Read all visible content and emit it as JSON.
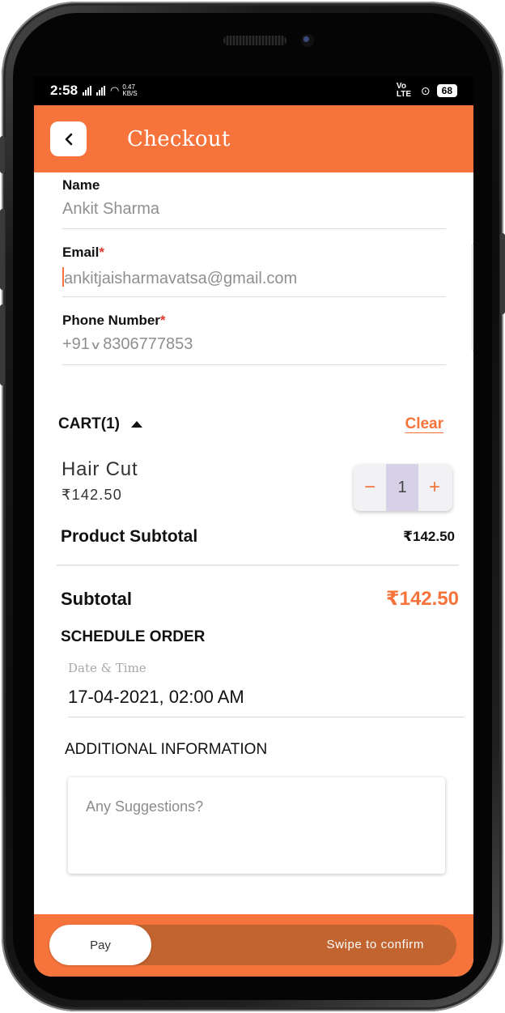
{
  "status_bar": {
    "time": "2:58",
    "net_speed_value": "0.47",
    "net_speed_unit": "KB/S",
    "volte": "Vo LTE",
    "battery": "68"
  },
  "header": {
    "back_icon": "chevron-left-icon",
    "title": "Checkout"
  },
  "form": {
    "name_label": "Name",
    "name_value": "Ankit Sharma",
    "email_label": "Email",
    "email_required": "*",
    "email_value": "ankitjaisharmavatsa@gmail.com",
    "phone_label": "Phone Number",
    "phone_required": "*",
    "country_code": "+91",
    "phone_value": "8306777853"
  },
  "cart": {
    "title": "CART(1)",
    "clear_label": "Clear",
    "items": [
      {
        "name": "Hair Cut",
        "price": "₹142.50",
        "quantity": "1"
      }
    ],
    "stepper_minus": "−",
    "stepper_plus": "+",
    "product_subtotal_label": "Product Subtotal",
    "product_subtotal_value": "₹142.50",
    "subtotal_label": "Subtotal",
    "subtotal_value": "₹142.50"
  },
  "schedule": {
    "title": "SCHEDULE ORDER",
    "date_label": "Date & Time",
    "date_value": "17-04-2021, 02:00 AM"
  },
  "additional": {
    "title": "ADDITIONAL INFORMATION",
    "placeholder": "Any Suggestions?"
  },
  "swipe": {
    "pay_label": "Pay",
    "hint": "Swipe to confirm"
  },
  "colors": {
    "accent": "#f6743c",
    "swipe_track": "#c2642f",
    "required": "#e13a2e"
  }
}
